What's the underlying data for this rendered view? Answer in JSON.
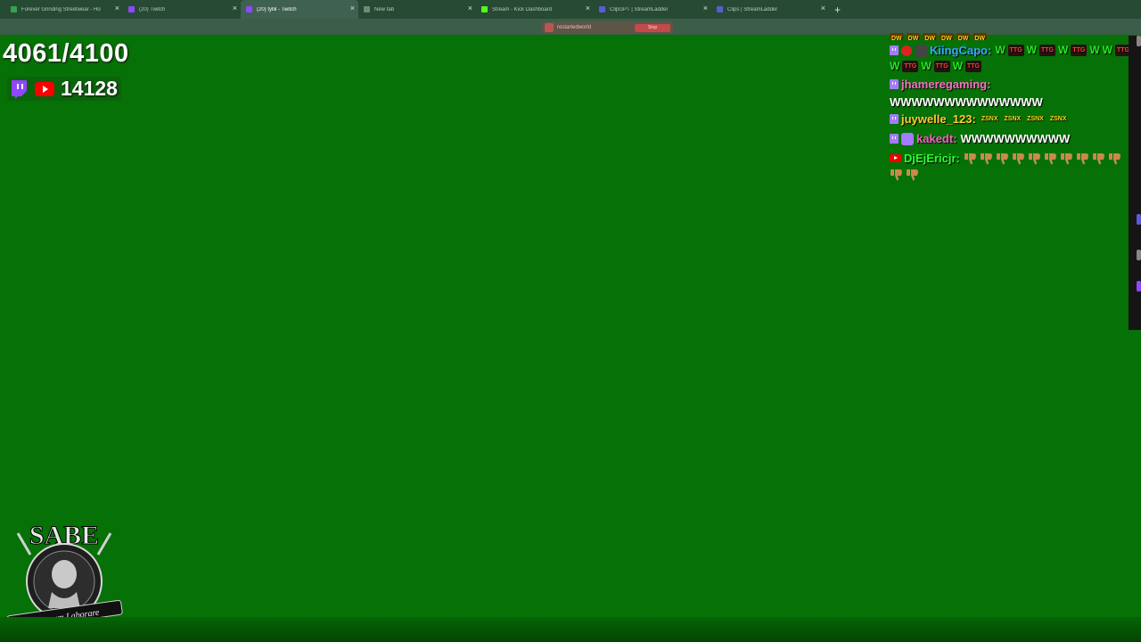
{
  "browser": {
    "tabs": [
      {
        "title": "Forever Grinding Streetwear - Ho",
        "fav": "#37a14f",
        "active": false
      },
      {
        "title": "(20) Twitch",
        "fav": "#9146ff",
        "active": false
      },
      {
        "title": "(20) tyllil - Twitch",
        "fav": "#9146ff",
        "active": true
      },
      {
        "title": "New tab",
        "fav": "#6e8a7a",
        "active": false
      },
      {
        "title": "Stream - Kick Dashboard",
        "fav": "#53fc18",
        "active": false
      },
      {
        "title": "ClipGPT | StreamLadder",
        "fav": "#5b5bd6",
        "active": false
      },
      {
        "title": "Clips | StreamLadder",
        "fav": "#5b5bd6",
        "active": false
      }
    ],
    "new_tab_label": "+",
    "close_glyph": "×",
    "recording_pill": {
      "text": "restartedworld",
      "button": "Stop"
    }
  },
  "overlay": {
    "goal": "4061/4100",
    "viewer_count": "14128",
    "platform_icons": [
      "twitch-icon",
      "youtube-icon"
    ]
  },
  "chat": {
    "lines": [
      {
        "user": "KiingCapo:",
        "color": "#3aa8ff",
        "platform": "twitch"
      },
      {
        "user": "jhameregaming:",
        "color": "#ff6ec7",
        "platform": "twitch",
        "message": "WWWWWWWWWWWWWW"
      },
      {
        "user": "juywelle_123:",
        "color": "#ffcc33",
        "platform": "twitch"
      },
      {
        "user": "kakedt:",
        "color": "#ff5cc8",
        "platform": "twitch",
        "message": "WWWWWWWWWW"
      },
      {
        "user": "DjEjEricjr:",
        "color": "#2cff2c",
        "platform": "youtube"
      }
    ],
    "emote_labels": {
      "dw": "DW",
      "ttg": "TTG",
      "w": "W",
      "z": "ZSNX"
    }
  },
  "logo": {
    "top_text": "SABE",
    "ribbon_text": "Aeternum Laborare"
  },
  "colors": {
    "background": "#067106",
    "tabbar": "#274a34"
  }
}
